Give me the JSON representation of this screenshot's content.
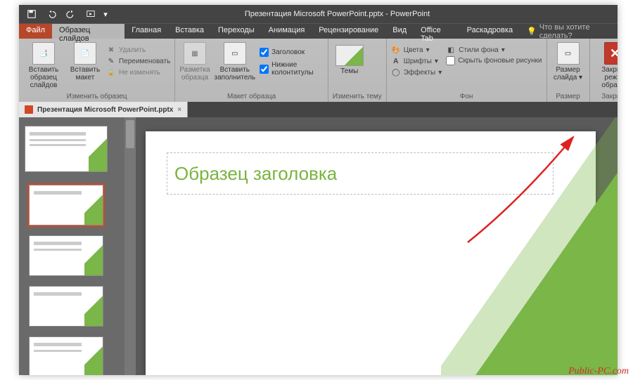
{
  "title": "Презентация Microsoft PowerPoint.pptx - PowerPoint",
  "tabs": {
    "file": "Файл",
    "master": "Образец слайдов",
    "home": "Главная",
    "insert": "Вставка",
    "transitions": "Переходы",
    "animations": "Анимация",
    "review": "Рецензирование",
    "view": "Вид",
    "officetab": "Office Tab",
    "storyboard": "Раскадровка"
  },
  "tell_me_placeholder": "Что вы хотите сделать?",
  "ribbon": {
    "edit_master": {
      "insert_master": "Вставить образец слайдов",
      "insert_layout": "Вставить макет",
      "delete": "Удалить",
      "rename": "Переименовать",
      "preserve": "Не изменять",
      "group": "Изменить образец"
    },
    "master_layout": {
      "layout": "Разметка образца",
      "placeholder": "Вставить заполнитель",
      "title_cb": "Заголовок",
      "footers_cb": "Нижние колонтитулы",
      "group": "Макет образца"
    },
    "edit_theme": {
      "themes": "Темы",
      "group": "Изменить тему"
    },
    "background": {
      "colors": "Цвета",
      "fonts": "Шрифты",
      "effects": "Эффекты",
      "styles": "Стили фона",
      "hide_bg": "Скрыть фоновые рисунки",
      "group": "Фон"
    },
    "size": {
      "slide_size": "Размер слайда",
      "group": "Размер"
    },
    "close": {
      "close_master": "Закрыть режим образца",
      "group": "Закрыть"
    }
  },
  "doc_tab": "Презентация Microsoft PowerPoint.pptx",
  "slide_title_placeholder": "Образец заголовка",
  "watermark": "Public-PC.com"
}
